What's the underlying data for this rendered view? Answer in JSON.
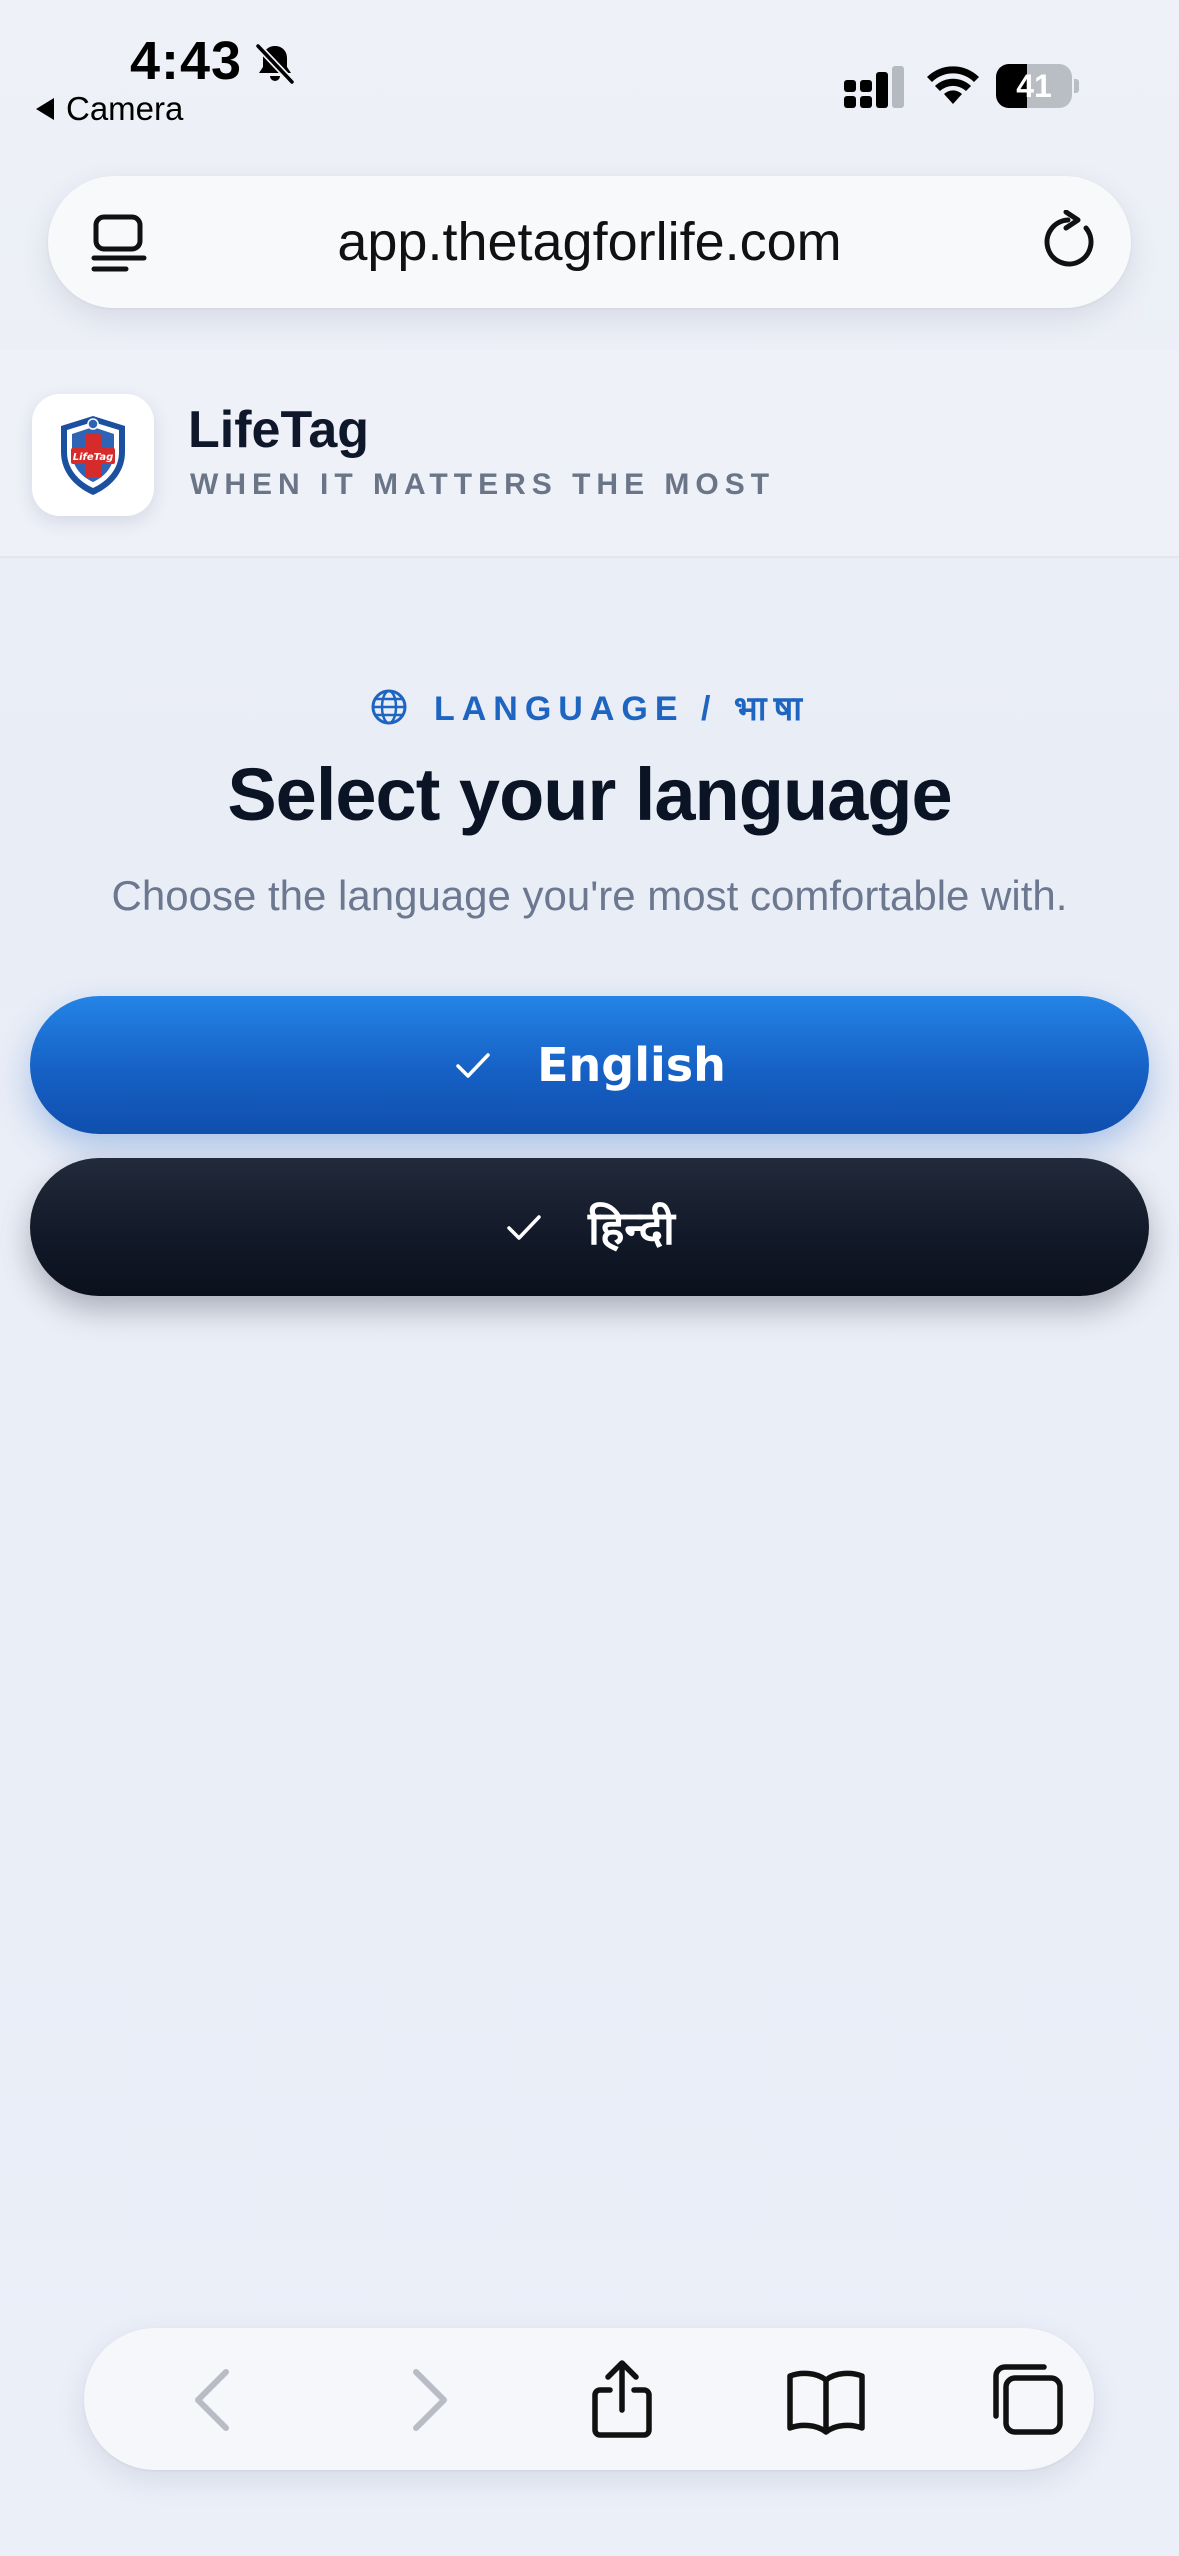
{
  "status_bar": {
    "time": "4:43",
    "back_app": "Camera",
    "battery": "41",
    "battery_level": 0.41
  },
  "url_bar": {
    "url": "app.thetagforlife.com"
  },
  "app_header": {
    "brand_name": "LifeTag",
    "tagline": "WHEN IT MATTERS THE MOST",
    "logo_text": "LifeTag"
  },
  "language": {
    "eyebrow": "LANGUAGE / भाषा",
    "title": "Select your language",
    "subtitle": "Choose the language you're most comfortable with.",
    "options": [
      {
        "label": "English",
        "selected": true
      },
      {
        "label": "हिन्दी",
        "selected": false
      }
    ]
  },
  "colors": {
    "accent": "#1660c4",
    "dark_button": "#111827",
    "eyebrow": "#1d65c1",
    "logo_red": "#d62b2b"
  },
  "icons": {
    "bell": "bell-slash-icon",
    "signal": "cellular-signal-icon",
    "wifi": "wifi-icon",
    "tabs": "tab-overview-icon",
    "reload": "reload-icon",
    "globe": "globe-icon",
    "check": "checkmark-icon",
    "back": "chevron-left-icon",
    "forward": "chevron-right-icon",
    "share": "share-icon",
    "bookmarks": "book-icon",
    "all_tabs": "tabs-icon"
  }
}
